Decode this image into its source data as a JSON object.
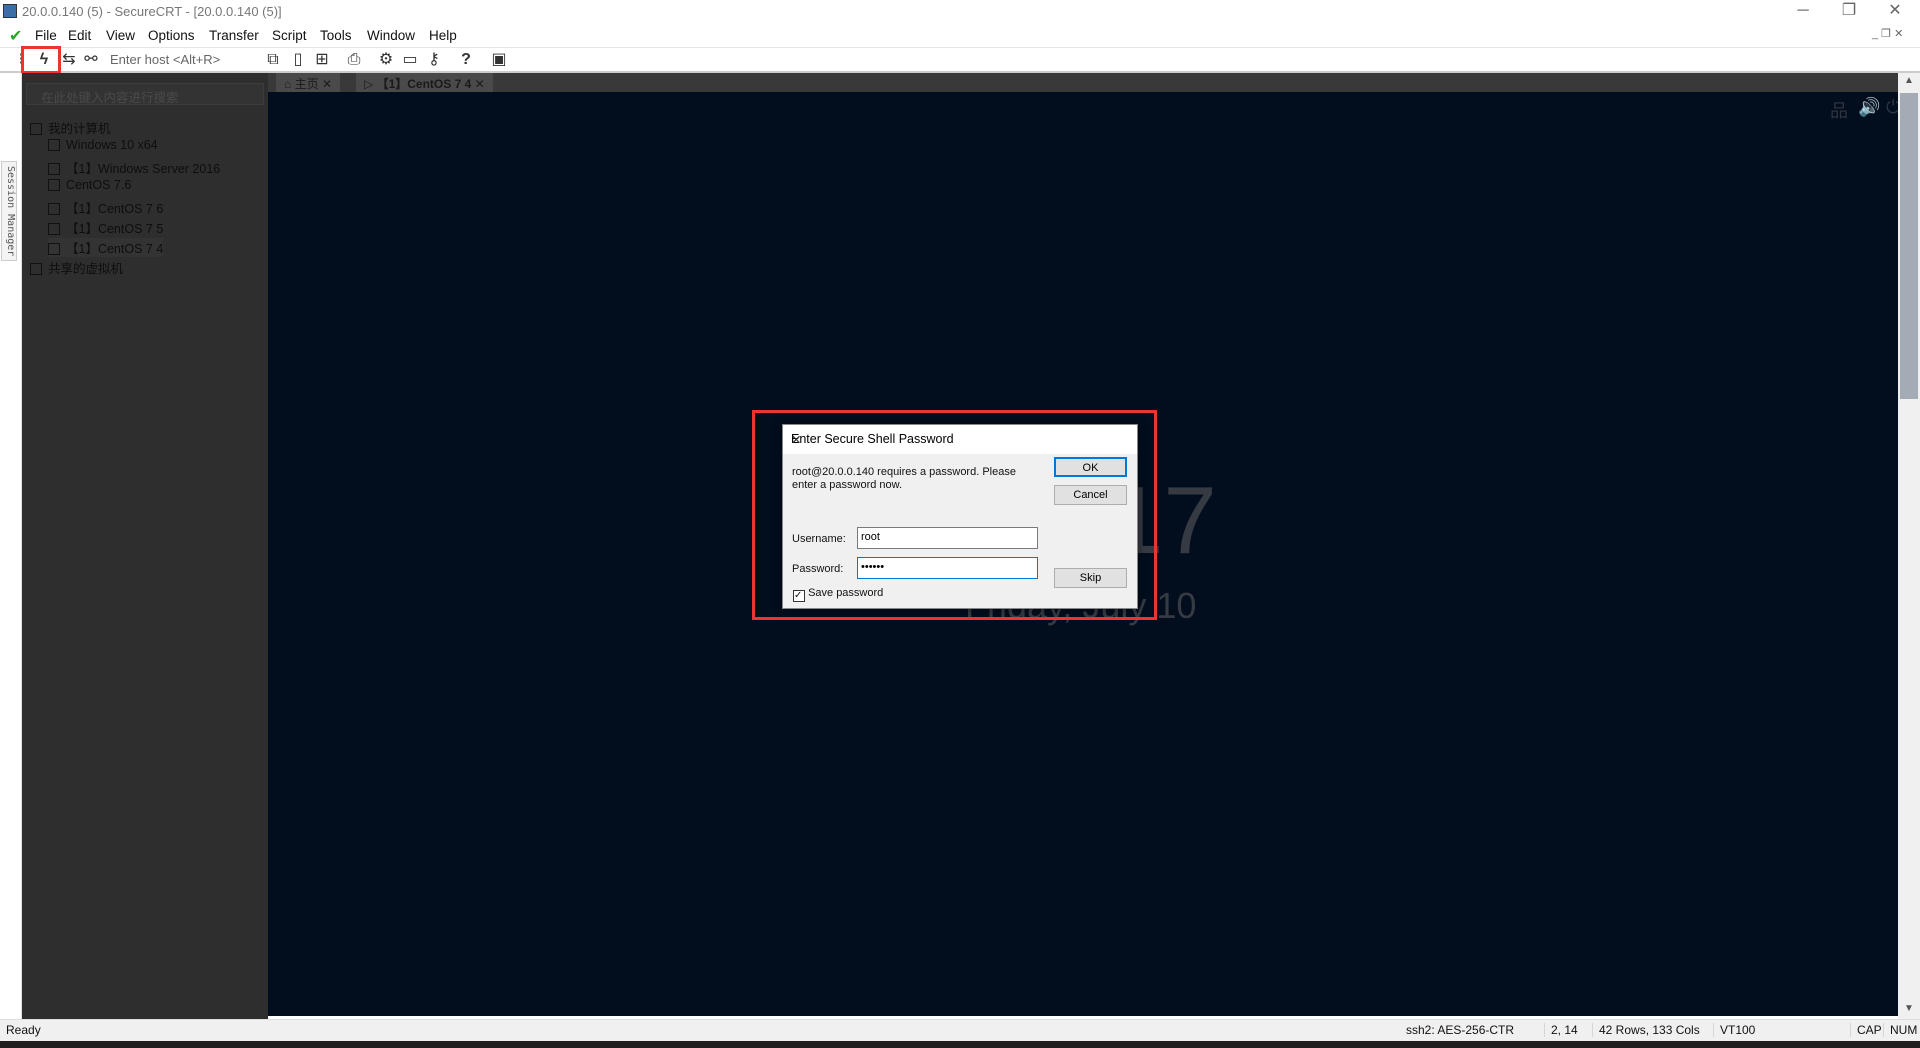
{
  "window": {
    "title": "20.0.0.140 (5) - SecureCRT - [20.0.0.140 (5)]"
  },
  "menu": [
    "File",
    "Edit",
    "View",
    "Options",
    "Transfer",
    "Script",
    "Tools",
    "Window",
    "Help"
  ],
  "toolbar": {
    "host_placeholder": "Enter host <Alt+R>",
    "connect_icon": "lightning-icon",
    "highlight_color": "#ee3333"
  },
  "tabs": [
    {
      "label": "主页"
    },
    {
      "label": "【1】CentOS 7 4"
    }
  ],
  "session_manager": {
    "label": "Session Manager",
    "search_placeholder": "在此处键入内容进行搜索",
    "tree": [
      {
        "label": "我的计算机",
        "level": 0
      },
      {
        "label": "Windows 10 x64",
        "level": 1
      },
      {
        "label": "【1】Windows Server 2016",
        "level": 1
      },
      {
        "label": "CentOS 7.6",
        "level": 1
      },
      {
        "label": "【1】CentOS 7 6",
        "level": 1
      },
      {
        "label": "【1】CentOS 7 5",
        "level": 1
      },
      {
        "label": "【1】CentOS 7 4",
        "level": 1
      },
      {
        "label": "共享的虚拟机",
        "level": 0
      }
    ]
  },
  "terminal": {
    "clock": "17",
    "date": "Friday, July 10"
  },
  "dialog": {
    "title": "Enter Secure Shell Password",
    "message_line1": "root@20.0.0.140 requires a password.  Please",
    "message_line2": "enter a password now.",
    "username_label": "Username:",
    "username": "root",
    "password_label": "Password:",
    "password": "••••••",
    "save_password_label": "Save password",
    "save_password": true,
    "ok": "OK",
    "cancel": "Cancel",
    "skip": "Skip"
  },
  "status": {
    "ready": "Ready",
    "cipher": "ssh2: AES-256-CTR",
    "cursor": "2,  14",
    "size": "42 Rows, 133 Cols",
    "emulation": "VT100",
    "cap": "CAP",
    "num": "NUM"
  }
}
